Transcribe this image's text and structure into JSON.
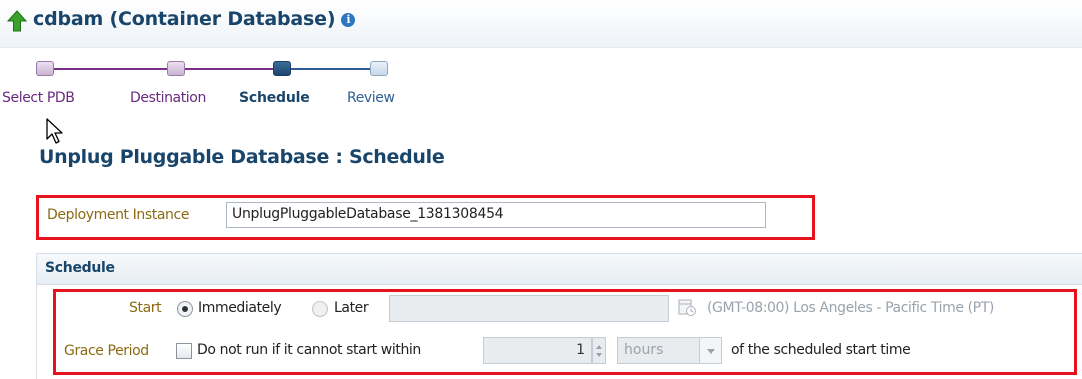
{
  "header": {
    "title": "cdbam (Container Database)",
    "info_icon_glyph": "i"
  },
  "train": {
    "steps": [
      {
        "label": "Select PDB",
        "state": "visited"
      },
      {
        "label": "Destination",
        "state": "visited"
      },
      {
        "label": "Schedule",
        "state": "current"
      },
      {
        "label": "Review",
        "state": "future"
      }
    ]
  },
  "page": {
    "title": "Unplug Pluggable Database : Schedule"
  },
  "deployment": {
    "label": "Deployment Instance",
    "value": "UnplugPluggableDatabase_1381308454"
  },
  "schedule": {
    "section_title": "Schedule",
    "start_label": "Start",
    "immediately_label": "Immediately",
    "later_label": "Later",
    "start_selected": "Immediately",
    "timezone": "(GMT-08:00) Los Angeles - Pacific Time (PT)",
    "grace_label": "Grace Period",
    "grace_checkbox_label": "Do not run if it cannot start within",
    "grace_checked": false,
    "grace_value": "1",
    "grace_unit": "hours",
    "grace_suffix": "of the scheduled start time"
  },
  "colors": {
    "highlight_border": "#e8121c",
    "title_blue": "#19456b",
    "train_visited": "#7a2f86",
    "label_gold": "#8a6a14"
  },
  "icons": [
    "up-arrow-icon",
    "info-icon",
    "mouse-pointer-icon",
    "calendar-icon",
    "spinner-up-icon",
    "spinner-down-icon",
    "dropdown-arrow-icon"
  ]
}
